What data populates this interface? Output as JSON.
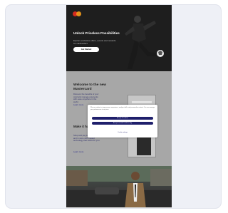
{
  "hero": {
    "logo_icon": "mastercard-logo",
    "title": "Unlock Priceless Possibilities",
    "subtitle": "Explore exclusive offers, events and rewards for cardholders",
    "cta_label": "Get Started"
  },
  "section1": {
    "title": "Welcome to the new Mastercard",
    "text": "Discover the benefits of your card and manage payments with ease anywhere in the world.",
    "link": "Learn more"
  },
  "section2": {
    "title": "Make it happen",
    "text": "Shop and pay securely online and in store with trusted technology that works for you.",
    "link": "Learn more"
  },
  "cookie_modal": {
    "text": "We use cookies to improve your experience, analyze traffic and personalise content. You can manage your preferences at any time.",
    "accept_label": "Accept all cookies",
    "essential_label": "Accept essential cookies only",
    "settings_label": "Cookie settings"
  },
  "colors": {
    "hero_bg": "#1e1e1e",
    "page_overlay": "#a7a7a7",
    "modal_button": "#1f1f6b"
  }
}
